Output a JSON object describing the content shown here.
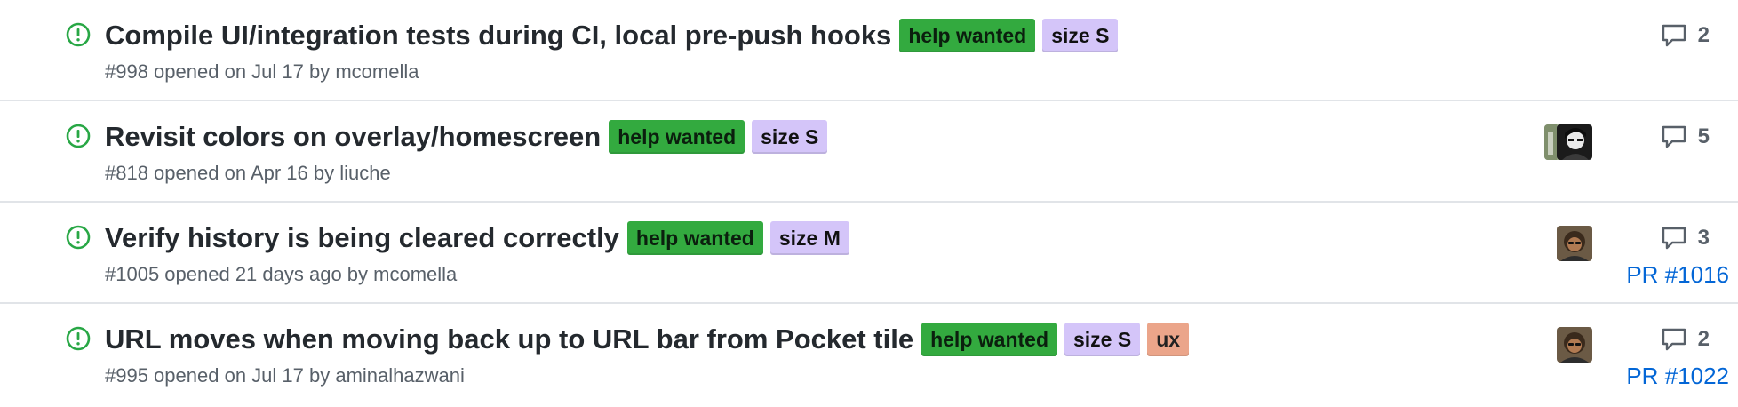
{
  "issues": [
    {
      "title": "Compile UI/integration tests during CI, local pre-push hooks",
      "labels": [
        {
          "text": "help wanted",
          "kind": "help"
        },
        {
          "text": "size S",
          "kind": "size"
        }
      ],
      "meta": "#998 opened on Jul 17 by mcomella",
      "comments": "2",
      "pr": "",
      "avatars": 0
    },
    {
      "title": "Revisit colors on overlay/homescreen",
      "labels": [
        {
          "text": "help wanted",
          "kind": "help"
        },
        {
          "text": "size S",
          "kind": "size"
        }
      ],
      "meta": "#818 opened on Apr 16 by liuche",
      "comments": "5",
      "pr": "",
      "avatars": 2
    },
    {
      "title": "Verify history is being cleared correctly",
      "labels": [
        {
          "text": "help wanted",
          "kind": "help"
        },
        {
          "text": "size M",
          "kind": "size"
        }
      ],
      "meta": "#1005 opened 21 days ago by mcomella",
      "comments": "3",
      "pr": "PR #1016",
      "avatars": 1
    },
    {
      "title": "URL moves when moving back up to URL bar from Pocket tile",
      "labels": [
        {
          "text": "help wanted",
          "kind": "help"
        },
        {
          "text": "size S",
          "kind": "size"
        },
        {
          "text": "ux",
          "kind": "ux"
        }
      ],
      "meta": "#995 opened on Jul 17 by aminalhazwani",
      "comments": "2",
      "pr": "PR #1022",
      "avatars": 1
    }
  ],
  "colors": {
    "open_icon": "#28a745",
    "title": "#24292e",
    "meta": "#586069",
    "link": "#0366d6",
    "label_help": "#33aa3f",
    "label_size": "#d4c5f9",
    "label_ux": "#eba58a",
    "divider": "#e1e4e8"
  },
  "icons": {
    "status": "issue-opened-icon",
    "comments": "comment-icon"
  }
}
